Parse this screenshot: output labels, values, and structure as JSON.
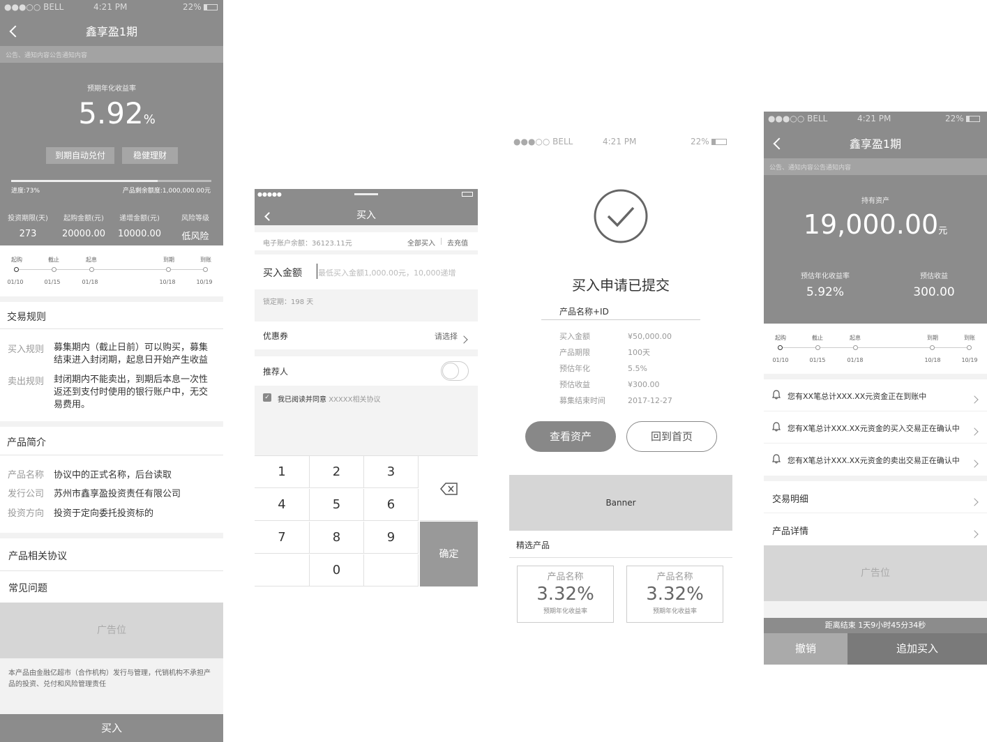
{
  "status": {
    "carrier": "●●●○○ BELL",
    "time": "4:21 PM",
    "battery": "22%"
  },
  "s1": {
    "title": "鑫享盈1期",
    "notice": "公告、通知内容公告通知内容",
    "rate_label": "预期年化收益率",
    "rate": "5.92",
    "rate_unit": "%",
    "tags": [
      "到期自动兑付",
      "稳健理财"
    ],
    "progress_text": "进度:73%",
    "progress": 0.73,
    "remaining": "产品剩余额度:1,000,000.00元",
    "stats": [
      {
        "label": "投资期限(天)",
        "value": "273"
      },
      {
        "label": "起购金额(元)",
        "value": "20000.00"
      },
      {
        "label": "递增金额(元)",
        "value": "10000.00"
      },
      {
        "label": "风险等级",
        "value": "低风险"
      }
    ],
    "timeline": [
      {
        "label": "起购",
        "date": "01/10"
      },
      {
        "label": "截止",
        "date": "01/15"
      },
      {
        "label": "起息",
        "date": "01/18"
      },
      {
        "label": "到期",
        "date": "10/18"
      },
      {
        "label": "到账",
        "date": "10/19"
      }
    ],
    "rules_title": "交易规则",
    "rules": [
      {
        "label": "买入规则",
        "text": "募集期内（截止日前）可以购买，募集结束进入封闭期，起息日开始产生收益"
      },
      {
        "label": "卖出规则",
        "text": "封闭期内不能卖出，到期后本息一次性返还到支付时使用的银行账户中，无交易费用。"
      }
    ],
    "intro_title": "产品简介",
    "intro": [
      {
        "label": "产品名称",
        "text": "协议中的正式名称，后台读取"
      },
      {
        "label": "发行公司",
        "text": "苏州市鑫享盈投资责任有限公司"
      },
      {
        "label": "投资方向",
        "text": "投资于定向委托投资标的"
      }
    ],
    "links": [
      "产品相关协议",
      "常见问题"
    ],
    "ad": "广告位",
    "disclaimer": "本产品由金融亿超市（合作机构）发行与管理，代销机构不承担产品的投资、兑付和风险管理责任",
    "buy": "买入"
  },
  "s2": {
    "title": "买入",
    "balance": "电子账户余额：36123.11元",
    "buy_all": "全部买入",
    "recharge": "去充值",
    "amount_label": "买入金额",
    "amount_placeholder": "最低买入金额1,000.00元，10,000递增",
    "lock": "锁定期：198 天",
    "coupon_label": "优惠券",
    "coupon_value": "请选择",
    "referrer": "推荐人",
    "agree_prefix": "我已阅读并同意",
    "agree_doc": "XXXXX相关协议",
    "keys": [
      "1",
      "2",
      "3",
      "4",
      "5",
      "6",
      "7",
      "8",
      "9",
      "0"
    ],
    "confirm": "确定"
  },
  "s3": {
    "heading": "买入申请已提交",
    "product": "产品名称+ID",
    "rows": [
      {
        "label": "买入金额",
        "value": "¥50,000.00"
      },
      {
        "label": "产品期限",
        "value": "100天"
      },
      {
        "label": "预估年化",
        "value": "5.5%"
      },
      {
        "label": "预估收益",
        "value": "¥300.00"
      },
      {
        "label": "募集结束时间",
        "value": "2017-12-27"
      }
    ],
    "btn_assets": "查看资产",
    "btn_home": "回到首页",
    "banner": "Banner",
    "featured": "精选产品",
    "cards": [
      {
        "name": "产品名称",
        "rate": "3.32%",
        "sub": "预期年化收益率"
      },
      {
        "name": "产品名称",
        "rate": "3.32%",
        "sub": "预期年化收益率"
      }
    ]
  },
  "s4": {
    "title": "鑫享盈1期",
    "notice": "公告、通知内容公告通知内容",
    "hold_label": "持有资产",
    "hold": "19,000.00",
    "hold_unit": "元",
    "rate_label": "预估年化收益率",
    "rate": "5.92%",
    "income_label": "预估收益",
    "income": "300.00",
    "timeline": [
      {
        "label": "起购",
        "date": "01/10"
      },
      {
        "label": "截止",
        "date": "01/15"
      },
      {
        "label": "起息",
        "date": "01/18"
      },
      {
        "label": "到期",
        "date": "10/18"
      },
      {
        "label": "到账",
        "date": "10/19"
      }
    ],
    "notices": [
      "您有XX笔总计XXX.XX元资金正在到账中",
      "您有X笔总计XXX.XX元资金的买入交易正在确认中",
      "您有X笔总计XXX.XX元资金的卖出交易正在确认中"
    ],
    "links": [
      "交易明细",
      "产品详情"
    ],
    "ad": "广告位",
    "countdown": "距离结束 1天9小时45分34秒",
    "cancel": "撤销",
    "add_buy": "追加买入"
  }
}
